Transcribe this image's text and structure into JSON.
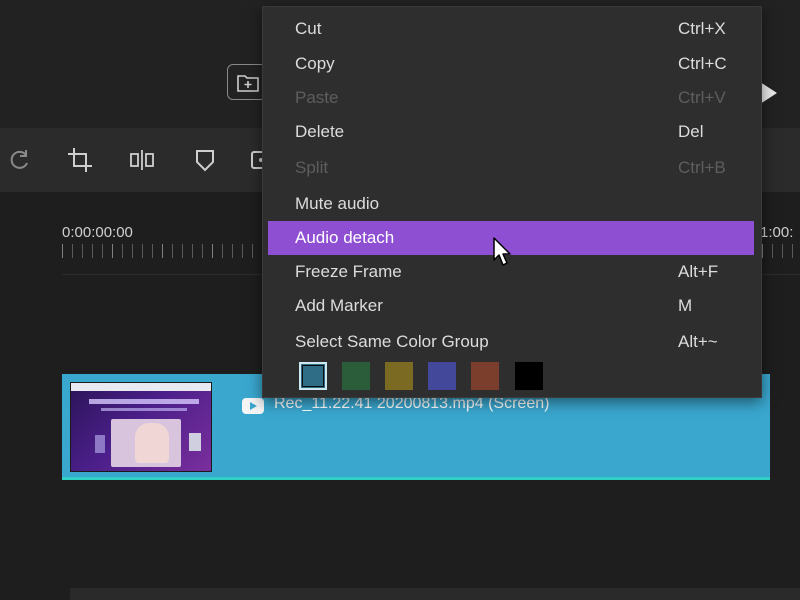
{
  "timeline": {
    "start_time": "0:00:00:00",
    "end_time_partial": "1:00:"
  },
  "clip": {
    "name": "Rec_11.22.41 20200813.mp4 (Screen)",
    "color": "#3aa7cf"
  },
  "context_menu": {
    "items": [
      {
        "label": "Cut",
        "shortcut": "Ctrl+X",
        "enabled": true
      },
      {
        "label": "Copy",
        "shortcut": "Ctrl+C",
        "enabled": true
      },
      {
        "label": "Paste",
        "shortcut": "Ctrl+V",
        "enabled": false
      },
      {
        "label": "Delete",
        "shortcut": "Del",
        "enabled": true
      },
      {
        "label": "Split",
        "shortcut": "Ctrl+B",
        "enabled": false
      },
      {
        "label": "Mute audio",
        "shortcut": "",
        "enabled": true
      },
      {
        "label": "Audio detach",
        "shortcut": "",
        "enabled": true,
        "highlighted": true
      },
      {
        "label": "Freeze Frame",
        "shortcut": "Alt+F",
        "enabled": true
      },
      {
        "label": "Add Marker",
        "shortcut": "M",
        "enabled": true
      },
      {
        "label": "Select Same Color Group",
        "shortcut": "Alt+~",
        "enabled": true
      }
    ],
    "highlight_color": "#8f4fd3",
    "color_swatches": [
      {
        "name": "blue",
        "color": "#2f6d86",
        "selected": true
      },
      {
        "name": "green",
        "color": "#2c5d3a"
      },
      {
        "name": "olive",
        "color": "#7a6a22"
      },
      {
        "name": "indigo",
        "color": "#43489a"
      },
      {
        "name": "brown",
        "color": "#7b3e2c"
      },
      {
        "name": "black",
        "color": "#000000"
      }
    ]
  },
  "toolbar": {
    "icons": [
      "redo-icon",
      "crop-icon",
      "split-icon",
      "marker-icon",
      "freeze-icon"
    ]
  },
  "icons": [
    "import-folder-icon",
    "play-icon",
    "video-clip-icon",
    "mouse-cursor-icon"
  ]
}
